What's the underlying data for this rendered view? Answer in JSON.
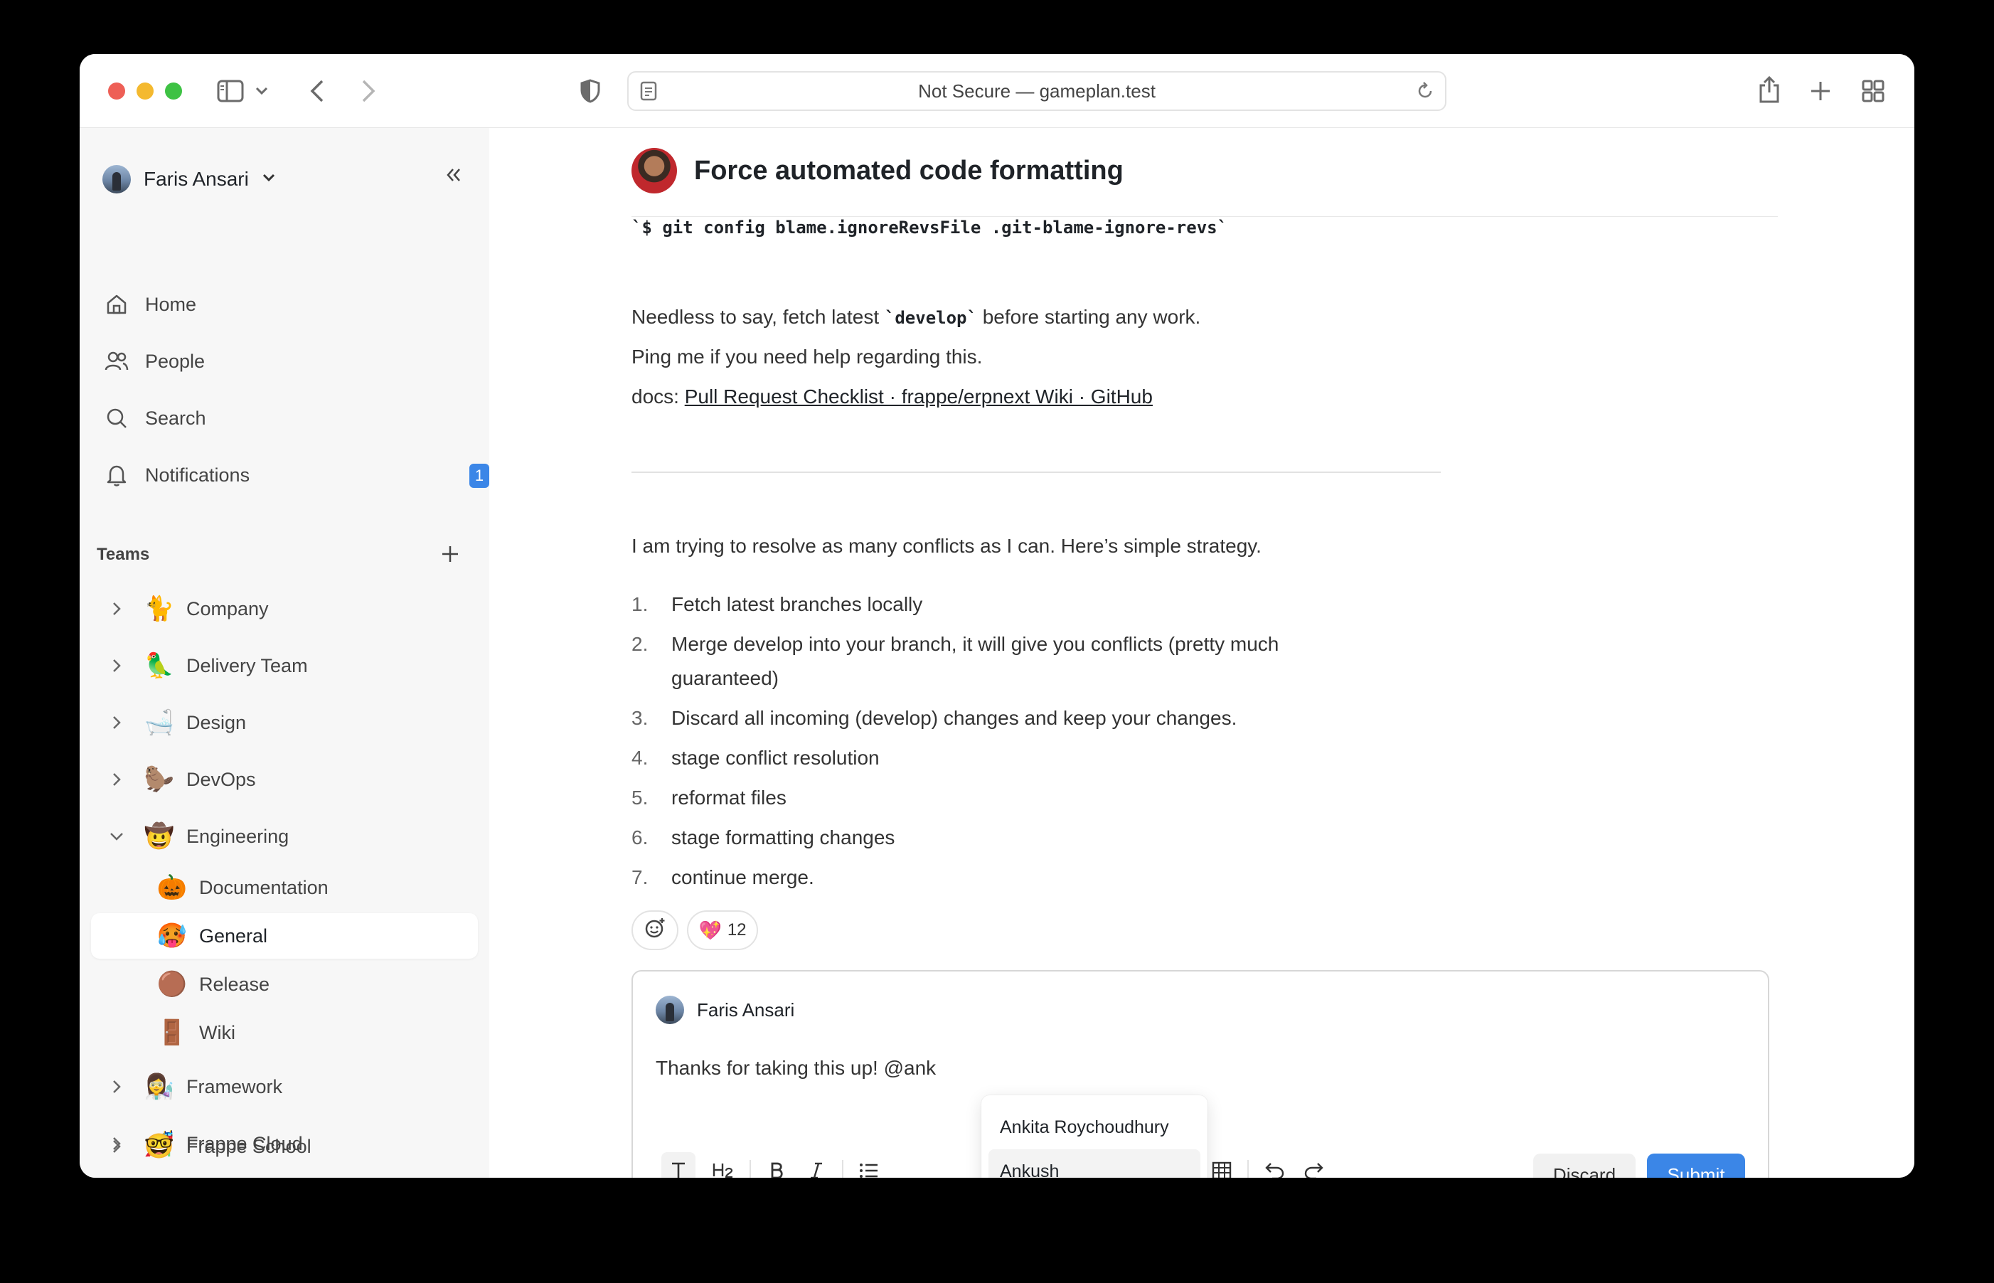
{
  "browser": {
    "url_text": "Not Secure — gameplan.test"
  },
  "sidebar": {
    "user_name": "Faris Ansari",
    "nav": [
      {
        "label": "Home"
      },
      {
        "label": "People"
      },
      {
        "label": "Search"
      },
      {
        "label": "Notifications",
        "badge": "1"
      }
    ],
    "teams_heading": "Teams",
    "teams": [
      {
        "emoji": "🐈",
        "label": "Company"
      },
      {
        "emoji": "🦜",
        "label": "Delivery Team"
      },
      {
        "emoji": "🛁",
        "label": "Design"
      },
      {
        "emoji": "🦫",
        "label": "DevOps"
      },
      {
        "emoji": "🤠",
        "label": "Engineering"
      }
    ],
    "subteams": [
      {
        "emoji": "🎃",
        "label": "Documentation"
      },
      {
        "emoji": "🥵",
        "label": "General"
      },
      {
        "emoji": "🟤",
        "label": "Release"
      },
      {
        "emoji": "🚪",
        "label": "Wiki"
      }
    ],
    "more_teams": [
      {
        "emoji": "👩‍🔬",
        "label": "Framework"
      },
      {
        "emoji": "🎢",
        "label": "Frappe Cloud"
      },
      {
        "emoji": "🤓",
        "label": "Frappe School"
      }
    ]
  },
  "post": {
    "title": "Force automated code formatting",
    "code_line": "`$ git config blame.ignoreRevsFile .git-blame-ignore-revs`",
    "p1_before": "Needless to say, fetch latest ",
    "p1_code": "`develop`",
    "p1_after": " before starting any work.",
    "p2": "Ping me if you need help regarding this.",
    "p3_prefix": "docs: ",
    "p3_link": "Pull Request Checklist · frappe/erpnext Wiki · GitHub",
    "p4": "I am trying to resolve as many conflicts as I can. Here’s simple strategy.",
    "steps": [
      {
        "num": "1.",
        "text": "Fetch latest branches locally"
      },
      {
        "num": "2.",
        "text": "Merge develop into your branch, it will give you conflicts (pretty much guaranteed)"
      },
      {
        "num": "3.",
        "text": "Discard all incoming (develop) changes and keep your changes."
      },
      {
        "num": "4.",
        "text": "stage conflict resolution"
      },
      {
        "num": "5.",
        "text": "reformat files"
      },
      {
        "num": "6.",
        "text": "stage formatting changes"
      },
      {
        "num": "7.",
        "text": "continue merge."
      }
    ],
    "reaction_emoji": "💖",
    "reaction_count": "12"
  },
  "composer": {
    "user_name": "Faris Ansari",
    "text": "Thanks for taking this up! @ank",
    "discard_label": "Discard",
    "submit_label": "Submit",
    "mentions": [
      "Ankita Roychoudhury",
      "Ankush"
    ]
  },
  "colors": {
    "accent": "#3b86e7",
    "traffic_red": "#ee5f56",
    "traffic_yellow": "#f4b92f",
    "traffic_green": "#3ec244"
  }
}
